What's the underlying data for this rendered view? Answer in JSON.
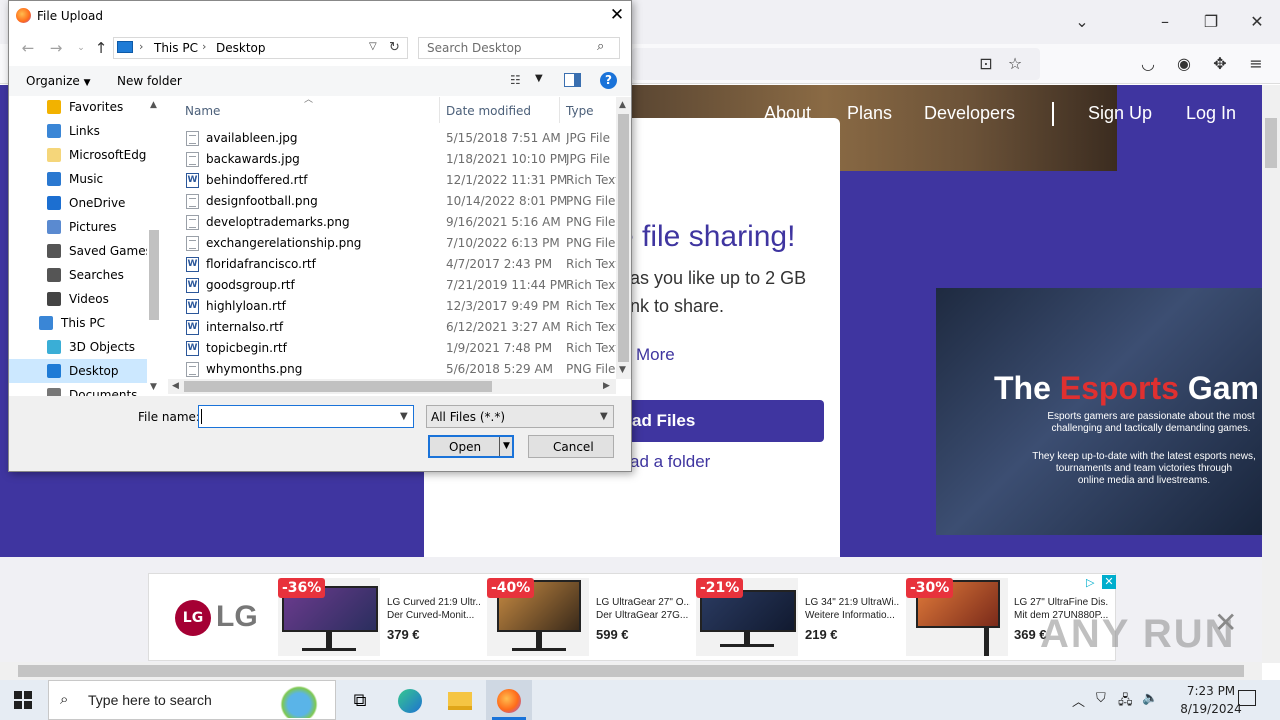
{
  "dialog": {
    "title": "File Upload",
    "breadcrumb": [
      "This PC",
      "Desktop"
    ],
    "search_placeholder": "Search Desktop",
    "toolbar": {
      "organize": "Organize",
      "new_folder": "New folder"
    },
    "columns": {
      "name": "Name",
      "date": "Date modified",
      "type": "Type"
    },
    "nav_items": [
      {
        "label": "Favorites",
        "icon": "star-icon"
      },
      {
        "label": "Links",
        "icon": "links-icon"
      },
      {
        "label": "MicrosoftEdge",
        "icon": "folder-icon"
      },
      {
        "label": "Music",
        "icon": "music-icon"
      },
      {
        "label": "OneDrive",
        "icon": "cloud-icon"
      },
      {
        "label": "Pictures",
        "icon": "pictures-icon"
      },
      {
        "label": "Saved Games",
        "icon": "saved-games-icon"
      },
      {
        "label": "Searches",
        "icon": "search-icon"
      },
      {
        "label": "Videos",
        "icon": "videos-icon"
      },
      {
        "label": "This PC",
        "icon": "computer-icon"
      },
      {
        "label": "3D Objects",
        "icon": "3d-objects-icon"
      },
      {
        "label": "Desktop",
        "icon": "desktop-icon",
        "selected": true
      },
      {
        "label": "Documents",
        "icon": "documents-icon"
      }
    ],
    "files": [
      {
        "name": "availableen.jpg",
        "date": "5/15/2018 7:51 AM",
        "type": "JPG File",
        "kind": "img"
      },
      {
        "name": "backawards.jpg",
        "date": "1/18/2021 10:10 PM",
        "type": "JPG File",
        "kind": "img"
      },
      {
        "name": "behindoffered.rtf",
        "date": "12/1/2022 11:31 PM",
        "type": "Rich Text",
        "kind": "rtf"
      },
      {
        "name": "designfootball.png",
        "date": "10/14/2022 8:01 PM",
        "type": "PNG File",
        "kind": "img"
      },
      {
        "name": "developtrademarks.png",
        "date": "9/16/2021 5:16 AM",
        "type": "PNG File",
        "kind": "img"
      },
      {
        "name": "exchangerelationship.png",
        "date": "7/10/2022 6:13 PM",
        "type": "PNG File",
        "kind": "img"
      },
      {
        "name": "floridafrancisco.rtf",
        "date": "4/7/2017 2:43 PM",
        "type": "Rich Text",
        "kind": "rtf"
      },
      {
        "name": "goodsgroup.rtf",
        "date": "7/21/2019 11:44 PM",
        "type": "Rich Text",
        "kind": "rtf"
      },
      {
        "name": "highlyloan.rtf",
        "date": "12/3/2017 9:49 PM",
        "type": "Rich Text",
        "kind": "rtf"
      },
      {
        "name": "internalso.rtf",
        "date": "6/12/2021 3:27 AM",
        "type": "Rich Text",
        "kind": "rtf"
      },
      {
        "name": "topicbegin.rtf",
        "date": "1/9/2021 7:48 PM",
        "type": "Rich Text",
        "kind": "rtf"
      },
      {
        "name": "whymonths.png",
        "date": "5/6/2018 5:29 AM",
        "type": "PNG File",
        "kind": "img"
      }
    ],
    "file_name_label": "File name:",
    "file_name_value": "",
    "file_type_value": "All Files (*.*)",
    "open_label": "Open",
    "cancel_label": "Cancel"
  },
  "site": {
    "nav": [
      "About",
      "Plans",
      "Developers",
      "Sign Up",
      "Log In"
    ],
    "heading_partial": "e file sharing!",
    "text_line1": "as you like up to 2 GB",
    "text_line2": "nk to share.",
    "learn_more_partial": "More",
    "upload_partial": "ad Files",
    "folder_partial": "ad a folder",
    "esports_title_a": "The ",
    "esports_title_b": "Esports",
    "esports_title_c": " Gam",
    "esports_p1a": "Esports gamers are passionate about the most",
    "esports_p1b": "challenging and tactically demanding games.",
    "esports_p2a": "They keep up-to-date with the latest esports news,",
    "esports_p2b": "tournaments and team victories through",
    "esports_p2c": "online media and livestreams."
  },
  "ad": {
    "brand": "LG",
    "items": [
      {
        "discount": "-36%",
        "name1": "LG Curved 21:9 Ultr...",
        "name2": "Der Curved-Monit...",
        "price": "379 €"
      },
      {
        "discount": "-40%",
        "name1": "LG UltraGear 27\" O...",
        "name2": "Der UltraGear 27G...",
        "price": "599 €"
      },
      {
        "discount": "-21%",
        "name1": "LG 34\" 21:9 UltraWi...",
        "name2": "Weitere Informatio...",
        "price": "219 €"
      },
      {
        "discount": "-30%",
        "name1": "LG 27\" UltraFine Dis...",
        "name2": "Mit dem 27UN880P...",
        "price": "369 €"
      }
    ]
  },
  "watermark": "ANY RUN",
  "taskbar": {
    "search_placeholder": "Type here to search",
    "time": "7:23 PM",
    "date": "8/19/2024"
  },
  "colors": {
    "site_primary": "#3f35a0",
    "selection": "#cce8ff",
    "accent": "#1a73d9",
    "discount": "#e8323c"
  }
}
